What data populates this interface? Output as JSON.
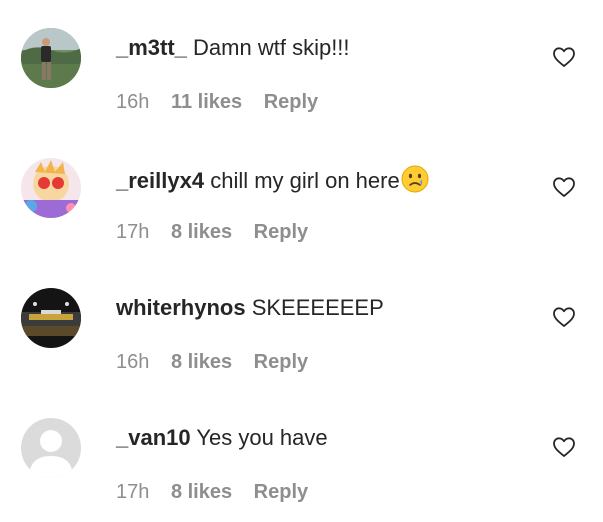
{
  "comments": [
    {
      "username": "_m3tt_",
      "text": "Damn wtf skip!!!",
      "time": "16h",
      "likes": "11 likes",
      "reply": "Reply",
      "avatar_icon": "person-outdoors-avatar",
      "emoji": ""
    },
    {
      "username": "_reillyx4",
      "text": "chill my girl on here",
      "time": "17h",
      "likes": "8 likes",
      "reply": "Reply",
      "avatar_icon": "cartoon-character-avatar",
      "emoji": "crying-face-emoji"
    },
    {
      "username": "whiterhynos",
      "text": "SKEEEEEEP",
      "time": "16h",
      "likes": "8 likes",
      "reply": "Reply",
      "avatar_icon": "arena-avatar",
      "emoji": ""
    },
    {
      "username": "_van10",
      "text": "Yes you have",
      "time": "17h",
      "likes": "8 likes",
      "reply": "Reply",
      "avatar_icon": "default-user-avatar",
      "emoji": ""
    }
  ],
  "heart_icon": "heart-outline-icon",
  "colors": {
    "text": "#262626",
    "meta": "#8e8e8e",
    "placeholder_avatar": "#dbdbdb"
  }
}
